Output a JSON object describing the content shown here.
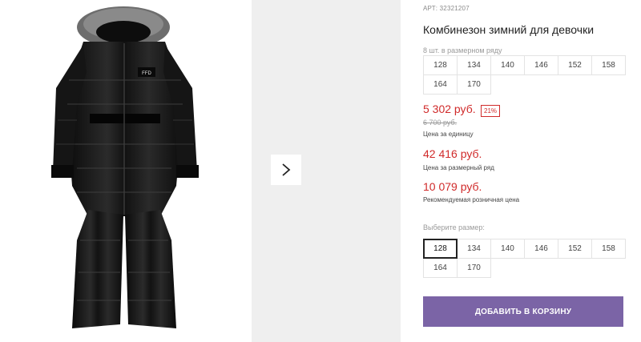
{
  "product": {
    "article": "АРТ: 32321207",
    "title": "Комбинезон зимний для девочки",
    "pack_note": "8 шт. в размерном ряду",
    "image_icon": "snowsuit-image",
    "logo_text": "FFD"
  },
  "gallery": {
    "next_icon": "chevron-right-icon"
  },
  "sizes_row": [
    "128",
    "134",
    "140",
    "146",
    "152",
    "158",
    "164",
    "170"
  ],
  "prices": {
    "unit_price": "5 302 руб.",
    "discount": "21%",
    "old_price": "6 700 руб.",
    "unit_label": "Цена за единицу",
    "pack_price": "42 416 руб.",
    "pack_label": "Цена за размерный ряд",
    "retail_price": "10 079 руб.",
    "retail_label": "Рекомендуемая розничная цена"
  },
  "size_select": {
    "label": "Выберите размер:",
    "options": [
      "128",
      "134",
      "140",
      "146",
      "152",
      "158",
      "164",
      "170"
    ],
    "selected": "128"
  },
  "cart": {
    "button_label": "ДОБАВИТЬ В КОРЗИНУ"
  },
  "colors": {
    "accent": "#7b64a6",
    "price": "#d02a2a"
  }
}
